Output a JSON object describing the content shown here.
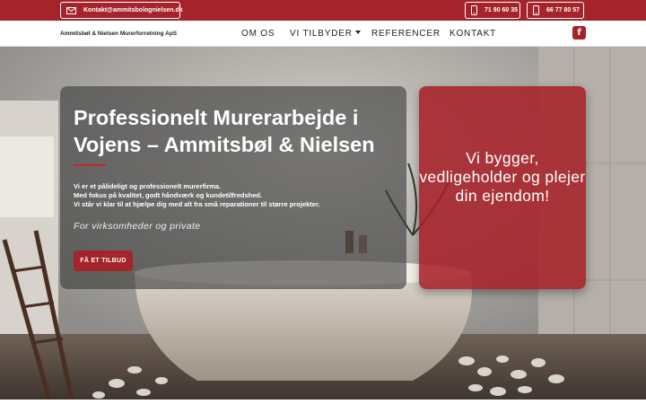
{
  "topbar": {
    "email": "Kontakt@ammitsbolognielsen.dk",
    "email_icon": "envelope-icon",
    "phone1": "71 90 60 35",
    "phone2": "66 77 80 57",
    "phone_icon": "mobile-phone-icon",
    "color": "#a5242b"
  },
  "nav": {
    "brand": "Ammitsbøl & Nielsen Murerforretning ApS",
    "items": [
      {
        "label": "OM OS"
      },
      {
        "label": "VI TILBYDER",
        "has_dropdown": true
      },
      {
        "label": "REFERENCER"
      },
      {
        "label": "KONTAKT"
      }
    ],
    "social_icon": "facebook-icon",
    "social_glyph": "f"
  },
  "hero": {
    "headline": "Professionelt Murerarbejde i Vojens – Ammitsbøl & Nielsen",
    "description": [
      "Vi er et pålideligt og professionelt murerfirma.",
      "Med fokus på kvalitet, godt håndværk og kundetilfredshed.",
      "Vi står vi klar til at hjælpe dig med alt fra små reparationer til større projekter."
    ],
    "tagline": "For virksomheder og private",
    "cta": "FÅ ET TILBUD",
    "slogan": "Vi bygger, vedligeholder og plejer din ejendom!",
    "background": "bathroom-with-freestanding-bathtub-photo"
  }
}
